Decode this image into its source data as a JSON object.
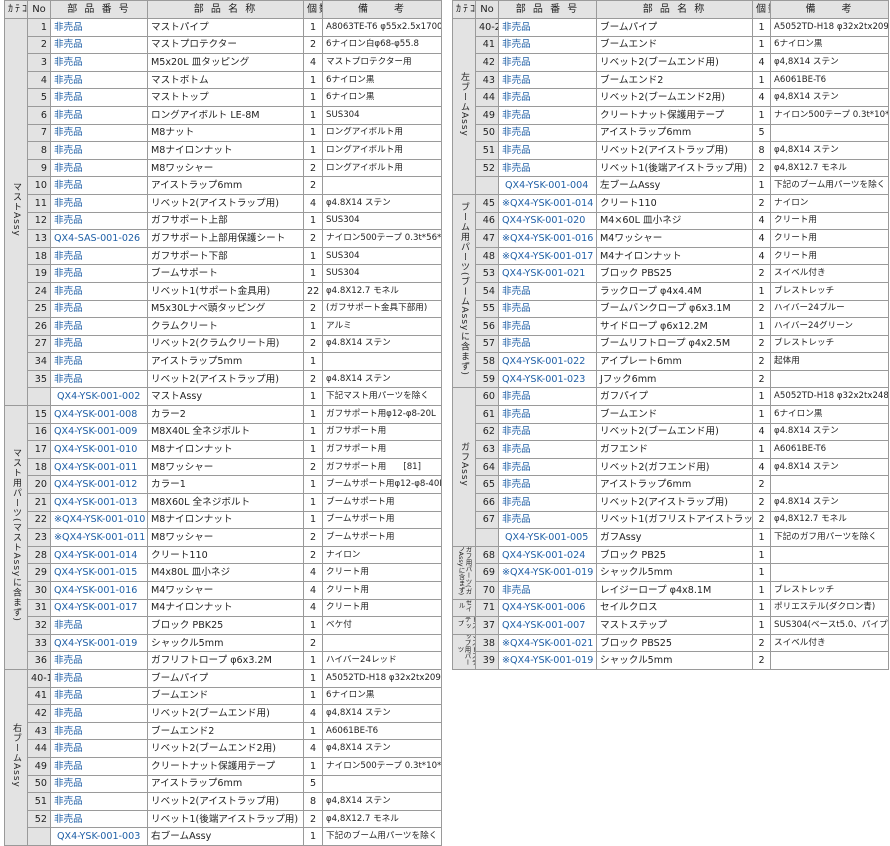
{
  "headers": {
    "category": "ｶﾃｺﾞﾘｰ",
    "no": "No",
    "part_number": "部 品 番 号",
    "part_name": "部 品 名 称",
    "count": "個数",
    "remarks": "備　　考"
  },
  "left_groups": [
    {
      "category": "マストAssy",
      "rows": [
        {
          "no": "1",
          "pn": "非売品",
          "name": "マストパイプ",
          "qty": "1",
          "remark": "A8063TE-T6 φ55x2.5x1700L"
        },
        {
          "no": "2",
          "pn": "非売品",
          "name": "マストプロテクター",
          "qty": "2",
          "remark": "6ナイロン白φ68-φ55.8"
        },
        {
          "no": "3",
          "pn": "非売品",
          "name": "M5x20L 皿タッピング",
          "qty": "4",
          "remark": "マストプロテクター用"
        },
        {
          "no": "4",
          "pn": "非売品",
          "name": "マストボトム",
          "qty": "1",
          "remark": "6ナイロン黒"
        },
        {
          "no": "5",
          "pn": "非売品",
          "name": "マストトップ",
          "qty": "1",
          "remark": "6ナイロン黒"
        },
        {
          "no": "6",
          "pn": "非売品",
          "name": "ロングアイボルト LE-8M",
          "qty": "1",
          "remark": "SUS304"
        },
        {
          "no": "7",
          "pn": "非売品",
          "name": "M8ナット",
          "qty": "1",
          "remark": "ロングアイボルト用"
        },
        {
          "no": "8",
          "pn": "非売品",
          "name": "M8ナイロンナット",
          "qty": "1",
          "remark": "ロングアイボルト用"
        },
        {
          "no": "9",
          "pn": "非売品",
          "name": "M8ワッシャー",
          "qty": "2",
          "remark": "ロングアイボルト用"
        },
        {
          "no": "10",
          "pn": "非売品",
          "name": "アイストラップ6mm",
          "qty": "2",
          "remark": ""
        },
        {
          "no": "11",
          "pn": "非売品",
          "name": "リベット2(アイストラップ用)",
          "qty": "4",
          "remark": "φ4.8X14 ステン"
        },
        {
          "no": "12",
          "pn": "非売品",
          "name": "ガフサポート上部",
          "qty": "1",
          "remark": "SUS304"
        },
        {
          "no": "13",
          "pn": "QX4-SAS-001-026",
          "name": "ガフサポート上部用保護シート",
          "qty": "2",
          "remark": "ナイロン500テープ 0.3t*56*58"
        },
        {
          "no": "18",
          "pn": "非売品",
          "name": "ガフサポート下部",
          "qty": "1",
          "remark": "SUS304"
        },
        {
          "no": "19",
          "pn": "非売品",
          "name": "ブームサポート",
          "qty": "1",
          "remark": "SUS304"
        },
        {
          "no": "24",
          "pn": "非売品",
          "name": "リベット1(サポート金具用)",
          "qty": "22",
          "remark": "φ4.8X12.7 モネル"
        },
        {
          "no": "25",
          "pn": "非売品",
          "name": "M5x30Lナベ頭タッピング",
          "qty": "2",
          "remark": "(ガフサポート金具下部用)"
        },
        {
          "no": "26",
          "pn": "非売品",
          "name": "クラムクリート",
          "qty": "1",
          "remark": "アルミ"
        },
        {
          "no": "27",
          "pn": "非売品",
          "name": "リベット2(クラムクリート用)",
          "qty": "2",
          "remark": "φ4.8X14 ステン"
        },
        {
          "no": "34",
          "pn": "非売品",
          "name": "アイストラップ5mm",
          "qty": "1",
          "remark": ""
        },
        {
          "no": "35",
          "pn": "非売品",
          "name": "リベット2(アイストラップ用)",
          "qty": "2",
          "remark": "φ4.8X14 ステン"
        },
        {
          "no": "",
          "pn": "QX4-YSK-001-002",
          "name": "マストAssy",
          "qty": "1",
          "remark": "下記マスト用パーツを除く"
        }
      ]
    },
    {
      "category": "マスト用パーツ(マストAssyに含まず)",
      "rows": [
        {
          "no": "15",
          "pn": "QX4-YSK-001-008",
          "name": "カラー2",
          "qty": "1",
          "remark": "ガフサポート用φ12-φ8-20L"
        },
        {
          "no": "16",
          "pn": "QX4-YSK-001-009",
          "name": "M8X40L 全ネジボルト",
          "qty": "1",
          "remark": "ガフサポート用"
        },
        {
          "no": "17",
          "pn": "QX4-YSK-001-010",
          "name": "M8ナイロンナット",
          "qty": "1",
          "remark": "ガフサポート用"
        },
        {
          "no": "18",
          "pn": "QX4-YSK-001-011",
          "name": "M8ワッシャー",
          "qty": "2",
          "remark": "ガフサポート用　　[81]"
        },
        {
          "no": "20",
          "pn": "QX4-YSK-001-012",
          "name": "カラー1",
          "qty": "1",
          "remark": "ブームサポート用φ12-φ8-40L"
        },
        {
          "no": "21",
          "pn": "QX4-YSK-001-013",
          "name": "M8X60L 全ネジボルト",
          "qty": "1",
          "remark": "ブームサポート用"
        },
        {
          "no": "22",
          "pn": "※QX4-YSK-001-010",
          "name": "M8ナイロンナット",
          "qty": "1",
          "remark": "ブームサポート用"
        },
        {
          "no": "23",
          "pn": "※QX4-YSK-001-011",
          "name": "M8ワッシャー",
          "qty": "2",
          "remark": "ブームサポート用"
        },
        {
          "no": "28",
          "pn": "QX4-YSK-001-014",
          "name": "クリート110",
          "qty": "2",
          "remark": "ナイロン"
        },
        {
          "no": "29",
          "pn": "QX4-YSK-001-015",
          "name": "M4x80L 皿小ネジ",
          "qty": "4",
          "remark": "クリート用"
        },
        {
          "no": "30",
          "pn": "QX4-YSK-001-016",
          "name": "M4ワッシャー",
          "qty": "4",
          "remark": "クリート用"
        },
        {
          "no": "31",
          "pn": "QX4-YSK-001-017",
          "name": "M4ナイロンナット",
          "qty": "4",
          "remark": "クリート用"
        },
        {
          "no": "32",
          "pn": "非売品",
          "name": "ブロック PBK25",
          "qty": "1",
          "remark": "ベケ付"
        },
        {
          "no": "33",
          "pn": "QX4-YSK-001-019",
          "name": "シャックル5mm",
          "qty": "2",
          "remark": ""
        },
        {
          "no": "36",
          "pn": "非売品",
          "name": "ガフリフトロープ φ6x3.2M",
          "qty": "1",
          "remark": "ハイバー24レッド"
        }
      ]
    },
    {
      "category": "右ブームAssy",
      "rows": [
        {
          "no": "40-1",
          "pn": "非売品",
          "name": "ブームパイプ",
          "qty": "1",
          "remark": "A5052TD-H18 φ32x2tx2091L"
        },
        {
          "no": "41",
          "pn": "非売品",
          "name": "ブームエンド",
          "qty": "1",
          "remark": "6ナイロン黒"
        },
        {
          "no": "42",
          "pn": "非売品",
          "name": "リベット2(ブームエンド用)",
          "qty": "4",
          "remark": "φ4,8X14 ステン"
        },
        {
          "no": "43",
          "pn": "非売品",
          "name": "ブームエンド2",
          "qty": "1",
          "remark": "A6061BE-T6"
        },
        {
          "no": "44",
          "pn": "非売品",
          "name": "リベット2(ブームエンド2用)",
          "qty": "4",
          "remark": "φ4,8X14 ステン"
        },
        {
          "no": "49",
          "pn": "非売品",
          "name": "クリートナット保護用テープ",
          "qty": "1",
          "remark": "ナイロン500テープ 0.3t*10*50"
        },
        {
          "no": "50",
          "pn": "非売品",
          "name": "アイストラップ6mm",
          "qty": "5",
          "remark": ""
        },
        {
          "no": "51",
          "pn": "非売品",
          "name": "リベット2(アイストラップ用)",
          "qty": "8",
          "remark": "φ4,8X14 ステン"
        },
        {
          "no": "52",
          "pn": "非売品",
          "name": "リベット1(後端アイストラップ用)",
          "qty": "2",
          "remark": "φ4,8X12.7 モネル"
        },
        {
          "no": "",
          "pn": "QX4-YSK-001-003",
          "name": "右ブームAssy",
          "qty": "1",
          "remark": "下記のブーム用パーツを除く"
        }
      ]
    }
  ],
  "right_groups": [
    {
      "category": "左ブームAssy",
      "rows": [
        {
          "no": "40-2",
          "pn": "非売品",
          "name": "ブームパイプ",
          "qty": "1",
          "remark": "A5052TD-H18 φ32x2tx2091L"
        },
        {
          "no": "41",
          "pn": "非売品",
          "name": "ブームエンド",
          "qty": "1",
          "remark": "6ナイロン黒"
        },
        {
          "no": "42",
          "pn": "非売品",
          "name": "リベット2(ブームエンド用)",
          "qty": "4",
          "remark": "φ4,8X14 ステン"
        },
        {
          "no": "43",
          "pn": "非売品",
          "name": "ブームエンド2",
          "qty": "1",
          "remark": "A6061BE-T6"
        },
        {
          "no": "44",
          "pn": "非売品",
          "name": "リベット2(ブームエンド2用)",
          "qty": "4",
          "remark": "φ4,8X14 ステン"
        },
        {
          "no": "49",
          "pn": "非売品",
          "name": "クリートナット保護用テープ",
          "qty": "1",
          "remark": "ナイロン500テープ 0.3t*10*50"
        },
        {
          "no": "50",
          "pn": "非売品",
          "name": "アイストラップ6mm",
          "qty": "5",
          "remark": ""
        },
        {
          "no": "51",
          "pn": "非売品",
          "name": "リベット2(アイストラップ用)",
          "qty": "8",
          "remark": "φ4,8X14 ステン"
        },
        {
          "no": "52",
          "pn": "非売品",
          "name": "リベット1(後端アイストラップ用)",
          "qty": "2",
          "remark": "φ4,8X12.7 モネル"
        },
        {
          "no": "",
          "pn": "QX4-YSK-001-004",
          "name": "左ブームAssy",
          "qty": "1",
          "remark": "下記のブーム用パーツを除く"
        }
      ]
    },
    {
      "category": "ブーム用パーツ(ブームAssyに含まず)",
      "rows": [
        {
          "no": "45",
          "pn": "※QX4-YSK-001-014",
          "name": "クリート110",
          "qty": "2",
          "remark": "ナイロン"
        },
        {
          "no": "46",
          "pn": "QX4-YSK-001-020",
          "name": "M4×60L 皿小ネジ",
          "qty": "4",
          "remark": "クリート用"
        },
        {
          "no": "47",
          "pn": "※QX4-YSK-001-016",
          "name": "M4ワッシャー",
          "qty": "4",
          "remark": "クリート用"
        },
        {
          "no": "48",
          "pn": "※QX4-YSK-001-017",
          "name": "M4ナイロンナット",
          "qty": "4",
          "remark": "クリート用"
        },
        {
          "no": "53",
          "pn": "QX4-YSK-001-021",
          "name": "ブロック PBS25",
          "qty": "2",
          "remark": "スイベル付き"
        },
        {
          "no": "54",
          "pn": "非売品",
          "name": "ラックロープ φ4x4.4M",
          "qty": "1",
          "remark": "ブレストレッチ"
        },
        {
          "no": "55",
          "pn": "非売品",
          "name": "ブームバンクロープ φ6x3.1M",
          "qty": "2",
          "remark": "ハイバー24ブルー"
        },
        {
          "no": "56",
          "pn": "非売品",
          "name": "サイドロープ φ6x12.2M",
          "qty": "1",
          "remark": "ハイバー24グリーン"
        },
        {
          "no": "57",
          "pn": "非売品",
          "name": "ブームリフトロープ φ4x2.5M",
          "qty": "2",
          "remark": "ブレストレッチ"
        },
        {
          "no": "58",
          "pn": "QX4-YSK-001-022",
          "name": "アイプレート6mm",
          "qty": "2",
          "remark": "起体用"
        },
        {
          "no": "59",
          "pn": "QX4-YSK-001-023",
          "name": "Jフック6mm",
          "qty": "2",
          "remark": ""
        }
      ]
    },
    {
      "category": "ガフAssy",
      "rows": [
        {
          "no": "60",
          "pn": "非売品",
          "name": "ガフパイプ",
          "qty": "1",
          "remark": "A5052TD-H18 φ32x2tx2481L"
        },
        {
          "no": "61",
          "pn": "非売品",
          "name": "ブームエンド",
          "qty": "1",
          "remark": "6ナイロン黒"
        },
        {
          "no": "62",
          "pn": "非売品",
          "name": "リベット2(ブームエンド用)",
          "qty": "4",
          "remark": "φ4.8X14 ステン"
        },
        {
          "no": "63",
          "pn": "非売品",
          "name": "ガフエンド",
          "qty": "1",
          "remark": "A6061BE-T6"
        },
        {
          "no": "64",
          "pn": "非売品",
          "name": "リベット2(ガフエンド用)",
          "qty": "4",
          "remark": "φ4.8X14 ステン"
        },
        {
          "no": "65",
          "pn": "非売品",
          "name": "アイストラップ6mm",
          "qty": "2",
          "remark": ""
        },
        {
          "no": "66",
          "pn": "非売品",
          "name": "リベット2(アイストラップ用)",
          "qty": "2",
          "remark": "φ4.8X14 ステン"
        },
        {
          "no": "67",
          "pn": "非売品",
          "name": "リベット1(ガフリストアイストラップ用)",
          "qty": "2",
          "remark": "φ4,8X12.7 モネル"
        },
        {
          "no": "",
          "pn": "QX4-YSK-001-005",
          "name": "ガフAssy",
          "qty": "1",
          "remark": "下記のガフ用パーツを除く"
        }
      ]
    },
    {
      "category": "ガフ用パーツ(ガフAssyに含まず)",
      "small": true,
      "rows": [
        {
          "no": "68",
          "pn": "QX4-YSK-001-024",
          "name": "ブロック PB25",
          "qty": "1",
          "remark": ""
        },
        {
          "no": "69",
          "pn": "※QX4-YSK-001-019",
          "name": "シャックル5mm",
          "qty": "1",
          "remark": ""
        },
        {
          "no": "70",
          "pn": "非売品",
          "name": "レイジーロープ φ4x8.1M",
          "qty": "1",
          "remark": "ブレストレッチ"
        }
      ]
    },
    {
      "category": "セイル",
      "small": true,
      "rows": [
        {
          "no": "71",
          "pn": "QX4-YSK-001-006",
          "name": "セイルクロス",
          "qty": "1",
          "remark": "ポリエステル(ダクロン青)"
        }
      ]
    },
    {
      "category": "マストステップ",
      "small": true,
      "rows": [
        {
          "no": "37",
          "pn": "QX4-YSK-001-007",
          "name": "マストステップ",
          "qty": "1",
          "remark": "SUS304(ベースt5.0、パイプt3.0)"
        }
      ]
    },
    {
      "category": "マストステップ用パーツ",
      "small": true,
      "rows": [
        {
          "no": "38",
          "pn": "※QX4-YSK-001-021",
          "name": "ブロック PBS25",
          "qty": "2",
          "remark": "スイベル付き"
        },
        {
          "no": "39",
          "pn": "※QX4-YSK-001-019",
          "name": "シャックル5mm",
          "qty": "2",
          "remark": ""
        }
      ]
    }
  ]
}
